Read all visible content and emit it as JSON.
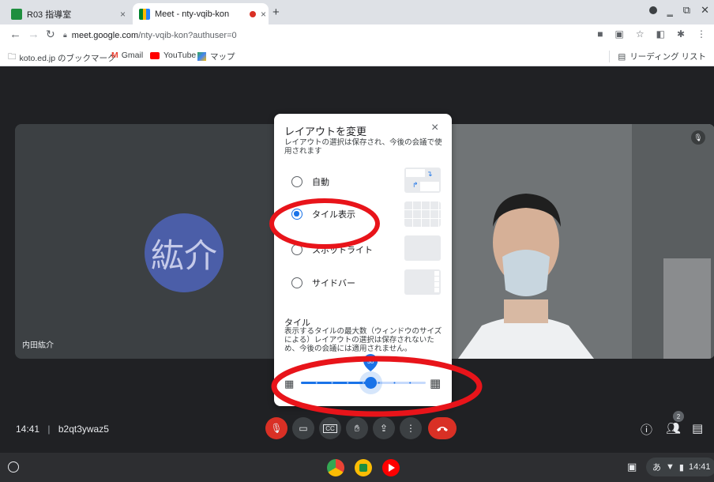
{
  "tabs": [
    {
      "title": "R03 指導室",
      "close": "×"
    },
    {
      "title": "Meet - nty-vqib-kon",
      "close": "×"
    }
  ],
  "new_tab": "+",
  "address": {
    "host": "meet.google.com",
    "path": "/nty-vqib-kon?authuser=0"
  },
  "bookmarks": [
    {
      "label": "koto.ed.jp のブックマーク"
    },
    {
      "label": "Gmail"
    },
    {
      "label": "YouTube"
    },
    {
      "label": "マップ"
    }
  ],
  "reading_list": "リーディング リスト",
  "participants": {
    "left_avatar": "紘介",
    "left_name": "内田紘介"
  },
  "meeting": {
    "time": "14:41",
    "separator": "|",
    "code": "b2qt3ywaz5",
    "people_count": "2"
  },
  "dialog": {
    "title": "レイアウトを変更",
    "close": "×",
    "description": "レイアウトの選択は保存され、今後の会議で使用されます",
    "options": [
      {
        "label": "自動",
        "selected": false
      },
      {
        "label": "タイル表示",
        "selected": true
      },
      {
        "label": "スポットライト",
        "selected": false
      },
      {
        "label": "サイドバー",
        "selected": false
      }
    ],
    "tiles_heading": "タイル",
    "tiles_description": "表示するタイルの最大数（ウィンドウのサイズによる）レイアウトの選択は保存されないため、今後の会議には適用されません。",
    "slider": {
      "value": 30,
      "min": 6,
      "max": 49
    }
  },
  "shelf": {
    "ime": "あ",
    "clock": "14:41"
  },
  "colors": {
    "accent": "#1a73e8",
    "danger": "#d93025",
    "annotation": "#e8141a"
  }
}
